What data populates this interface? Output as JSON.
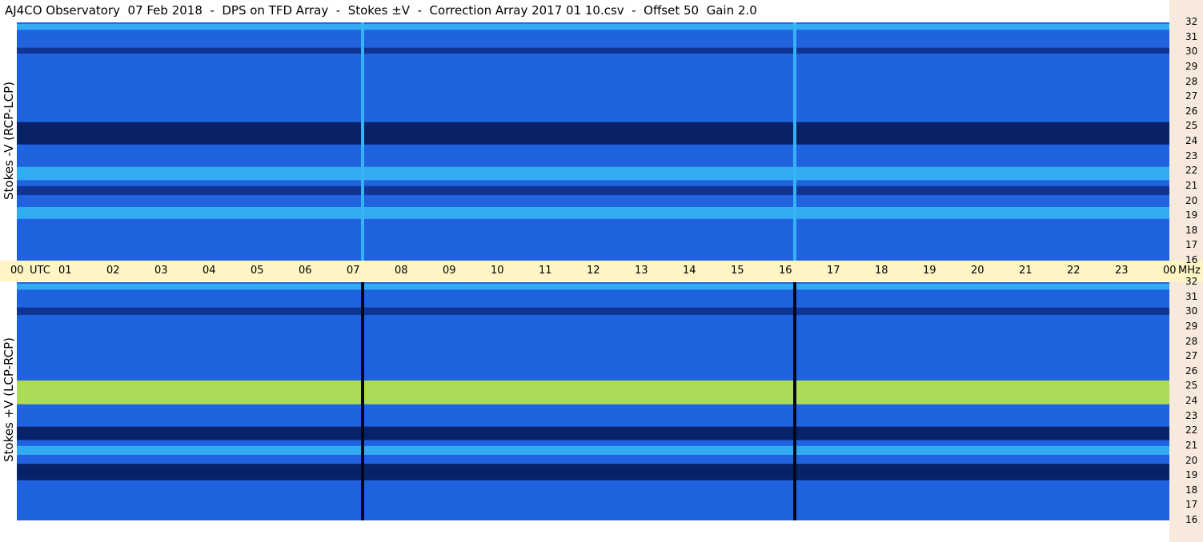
{
  "title": "AJ4CO Observatory  07 Feb 2018  -  DPS on TFD Array  -  Stokes ±V  -  Correction Array 2017 01 10.csv  -  Offset 50  Gain 2.0",
  "time_axis": {
    "labels": [
      "00",
      "01",
      "02",
      "03",
      "04",
      "05",
      "06",
      "07",
      "08",
      "09",
      "10",
      "11",
      "12",
      "13",
      "14",
      "15",
      "16",
      "17",
      "18",
      "19",
      "20",
      "21",
      "22",
      "23",
      "00"
    ],
    "utc_label": "UTC",
    "unit": "MHz"
  },
  "colors": {
    "background_blue": "#1f63de",
    "dark_band": "#061a5a",
    "bright_band": "#35b3f5",
    "hot_band": "#c8f040",
    "timebar": "#fdf5c4",
    "right_axis": "#f7e9dc"
  },
  "chart_data": [
    {
      "type": "heatmap",
      "panel": "upper",
      "ylabel": "Stokes -V (RCP-LCP)",
      "x_range_hours_utc": [
        0,
        24
      ],
      "ylim_mhz": [
        16,
        32
      ],
      "y_ticks": [
        32,
        31,
        30,
        29,
        28,
        27,
        26,
        25,
        24,
        23,
        22,
        21,
        20,
        19,
        18,
        17,
        16
      ],
      "dark_bands_mhz": [
        {
          "from": 23.8,
          "to": 25.3,
          "intensity": "very dark"
        },
        {
          "from": 20.4,
          "to": 21.0,
          "intensity": "dark"
        },
        {
          "from": 29.9,
          "to": 30.3,
          "intensity": "dark"
        }
      ],
      "bright_bands_mhz": [
        {
          "from": 21.4,
          "to": 22.3,
          "intensity": "bright"
        },
        {
          "from": 18.8,
          "to": 19.6,
          "intensity": "bright"
        },
        {
          "from": 31.5,
          "to": 31.9,
          "intensity": "bright"
        }
      ],
      "vertical_lines_hours_utc": [
        7.2,
        16.2
      ],
      "vertical_line_color": "bright"
    },
    {
      "type": "heatmap",
      "panel": "lower",
      "ylabel": "Stokes +V (LCP-RCP)",
      "x_range_hours_utc": [
        0,
        24
      ],
      "ylim_mhz": [
        16,
        32
      ],
      "y_ticks": [
        32,
        31,
        30,
        29,
        28,
        27,
        26,
        25,
        24,
        23,
        22,
        21,
        20,
        19,
        18,
        17,
        16
      ],
      "dark_bands_mhz": [
        {
          "from": 21.4,
          "to": 22.3,
          "intensity": "very dark"
        },
        {
          "from": 18.7,
          "to": 19.8,
          "intensity": "very dark"
        },
        {
          "from": 29.8,
          "to": 30.3,
          "intensity": "dark"
        }
      ],
      "bright_bands_mhz": [
        {
          "from": 23.8,
          "to": 25.4,
          "intensity": "hot"
        },
        {
          "from": 20.4,
          "to": 21.0,
          "intensity": "bright"
        },
        {
          "from": 31.5,
          "to": 31.9,
          "intensity": "bright"
        }
      ],
      "vertical_lines_hours_utc": [
        7.2,
        16.2
      ],
      "vertical_line_color": "dark"
    }
  ]
}
